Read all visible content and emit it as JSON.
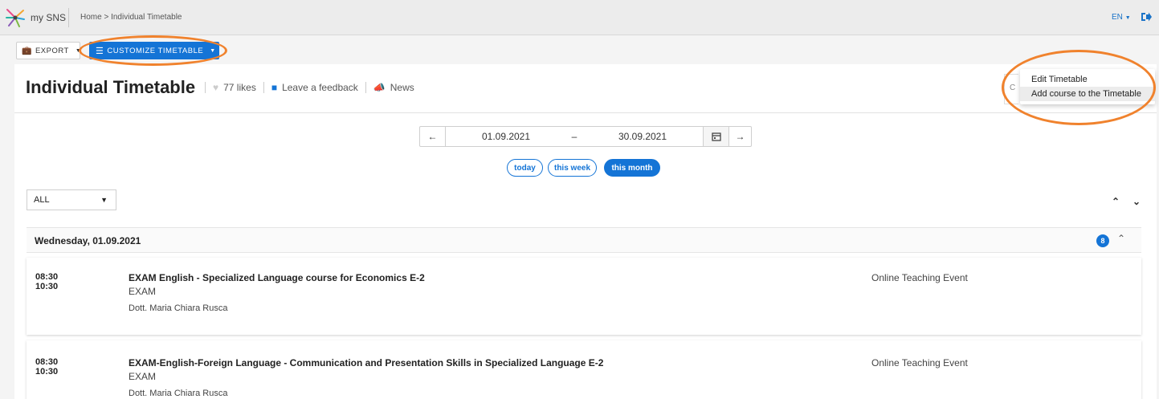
{
  "header": {
    "app_name": "my SNS",
    "breadcrumb_home": "Home",
    "breadcrumb_sep": ">",
    "breadcrumb_current": "Individual Timetable",
    "language": "EN"
  },
  "toolbar": {
    "export_label": "EXPORT",
    "customize_label": "CUSTOMIZE TIMETABLE"
  },
  "page": {
    "title": "Individual Timetable",
    "likes": "77 likes",
    "feedback": "Leave a feedback",
    "news": "News"
  },
  "date_range": {
    "from": "01.09.2021",
    "separator": "–",
    "to": "30.09.2021"
  },
  "quick_ranges": [
    "today",
    "this week",
    "this month"
  ],
  "active_quick_range": "this month",
  "filter": {
    "value": "ALL"
  },
  "day": {
    "title": "Wednesday, 01.09.2021",
    "count": "8"
  },
  "events": [
    {
      "start": "08:30",
      "end": "10:30",
      "title": "EXAM English - Specialized Language course for Economics E-2",
      "type": "EXAM",
      "teacher": "Dott. Maria Chiara Rusca",
      "mode": "Online Teaching Event"
    },
    {
      "start": "08:30",
      "end": "10:30",
      "title": "EXAM-English-Foreign Language - Communication and Presentation Skills in Specialized Language E-2",
      "type": "EXAM",
      "teacher": "Dott. Maria Chiara Rusca",
      "mode": "Online Teaching Event"
    }
  ],
  "menu": {
    "behind_text": "C",
    "items": [
      "Edit Timetable",
      "Add course to the Timetable"
    ]
  },
  "colors": {
    "accent": "#1474d6",
    "highlight_ring": "#f0822d"
  }
}
